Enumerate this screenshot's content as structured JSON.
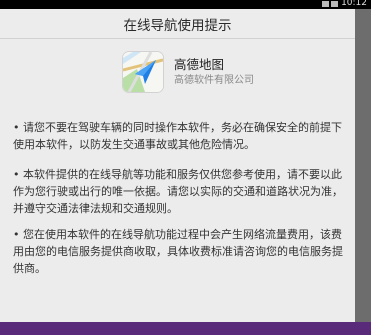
{
  "status_bar": {
    "time": "10:12"
  },
  "dialog": {
    "title": "在线导航使用提示",
    "app": {
      "name": "高德地图",
      "company": "高德软件有限公司",
      "icon": "amap-navigation-arrow-icon"
    },
    "notices": [
      "• 请您不要在驾驶车辆的同时操作本软件，务必在确保安全的前提下使用本软件，以防发生交通事故或其他危险情况。",
      "• 本软件提供的在线导航等功能和服务仅供您参考使用，请不要以此作为您行驶或出行的唯一依据。请您以实际的交通和道路状况为准，并遵守交通法律法规和交通规则。",
      "• 您在使用本软件的在线导航功能过程中会产生网络流量费用，该费用由您的电信服务提供商收取，具体收费标准请咨询您的电信服务提供商。"
    ]
  },
  "colors": {
    "dialog_bg": "#ececec",
    "accent_blue": "#1f7fe5"
  }
}
